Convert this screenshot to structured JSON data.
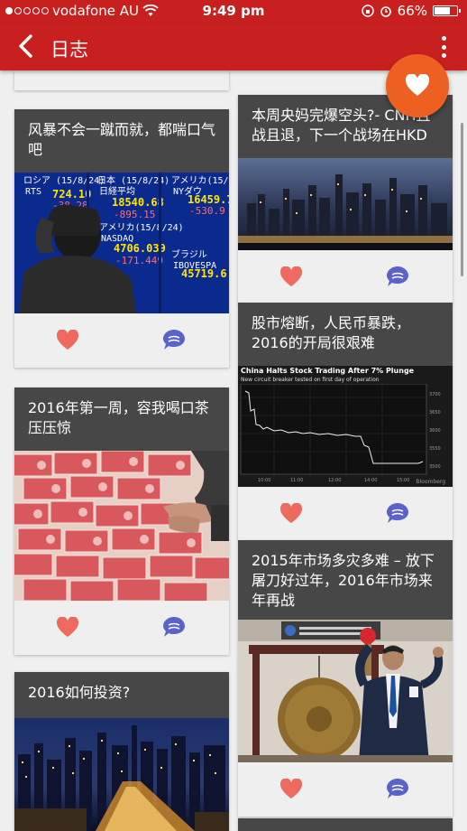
{
  "status": {
    "carrier": "vodafone AU",
    "time": "9:49 pm",
    "battery": "66%",
    "battery_level": 0.66
  },
  "app_bar": {
    "title": "日志"
  },
  "colors": {
    "brand_red": "#c8201f",
    "fab_orange": "#ee5f22",
    "like_red": "#ee6a5e",
    "comment_purple": "#5b62c9"
  },
  "cards": [
    {
      "title": "风暴不会一蹴而就，都喘口气吧",
      "image": "stock-board-photo"
    },
    {
      "title": "本周央妈完爆空头?- CNH且战且退，下一个战场在HKD",
      "image": "hong-kong-skyline-photo"
    },
    {
      "title": "2016年第一周，容我喝口茶压压惊",
      "image": "rmb-banknotes-photo"
    },
    {
      "title": "股市熔断，人民币暴跌，2016的开局很艰难",
      "image": "stock-chart-screenshot",
      "image_headline": "China Halts Stock Trading After 7% Plunge",
      "image_subhead": "New circuit breaker tested on first day of operation",
      "image_source": "Bloomberg"
    },
    {
      "title": "2015年市场多灾多难 – 放下屠刀好过年，2016年市场来年再战",
      "image": "gong-ceremony-photo"
    },
    {
      "title": "2016如何投资?",
      "image": "city-night-photo"
    }
  ]
}
